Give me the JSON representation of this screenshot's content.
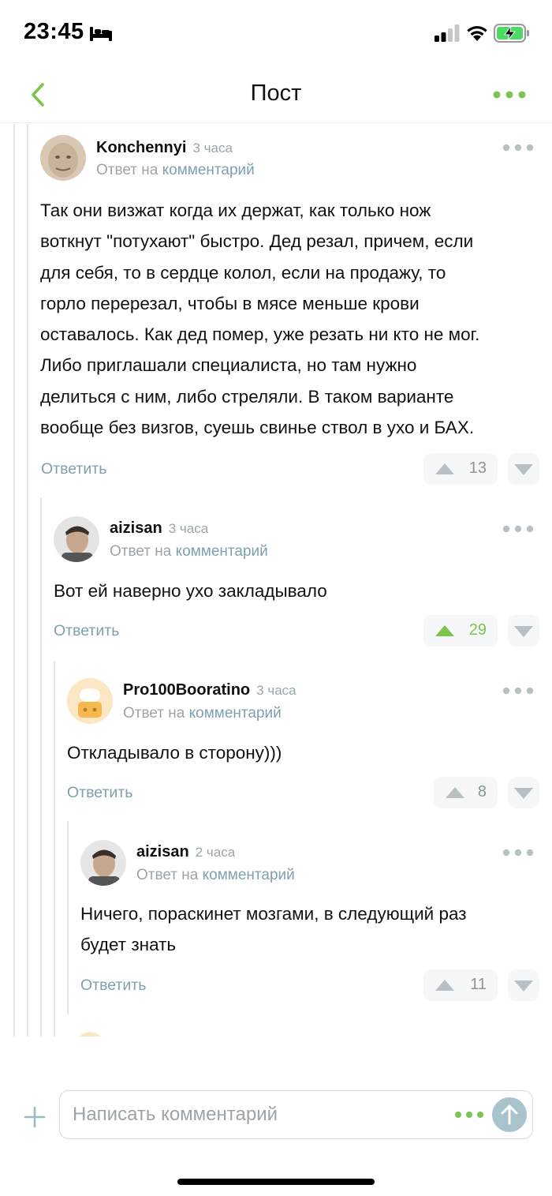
{
  "status_bar": {
    "time": "23:45",
    "icons": [
      "bed-icon",
      "signal-icon",
      "wifi-icon",
      "battery-charging-icon"
    ]
  },
  "nav": {
    "title": "Пост",
    "back_icon": "chevron-left-icon",
    "more_icon": "more-dots-icon"
  },
  "colors": {
    "accent_green": "#7cc44d",
    "link_teal": "#7da1ae",
    "muted": "#9aa5ab"
  },
  "comments": [
    {
      "author": "Konchennyi",
      "time": "3 часа",
      "reply_prefix": "Ответ на",
      "reply_link": "комментарий",
      "text_lines": [
        "Так они визжат когда их держат, как только нож",
        "воткнут \"потухают\" быстро. Дед резал, причем, если",
        "для себя, то в сердце колол, если на продажу, то",
        "горло перерезал, чтобы в мясе меньше крови",
        "оставалось. Как дед помер, уже резать ни кто не мог.",
        "Либо приглашали специалиста, но там нужно",
        "делиться с ним, либо стреляли. В таком варианте",
        "вообще без визгов, суешь свинье ствол в ухо и БАХ."
      ],
      "reply_label": "Ответить",
      "rating": "13",
      "upvoted": false
    },
    {
      "author": "aizisan",
      "time": "3 часа",
      "reply_prefix": "Ответ на",
      "reply_link": "комментарий",
      "text_lines": [
        "Вот ей наверно ухо закладывало"
      ],
      "reply_label": "Ответить",
      "rating": "29",
      "upvoted": true
    },
    {
      "author": "Pro100Booratino",
      "time": "3 часа",
      "reply_prefix": "Ответ на",
      "reply_link": "комментарий",
      "text_lines": [
        "Откладывало в сторону)))"
      ],
      "reply_label": "Ответить",
      "rating": "8",
      "upvoted": false
    },
    {
      "author": "aizisan",
      "time": "2 часа",
      "reply_prefix": "Ответ на",
      "reply_link": "комментарий",
      "text_lines": [
        "Ничего, пораскинет мозгами, в следующий раз",
        "будет знать"
      ],
      "reply_label": "Ответить",
      "rating": "11",
      "upvoted": false
    }
  ],
  "composer": {
    "placeholder": "Написать комментарий"
  }
}
